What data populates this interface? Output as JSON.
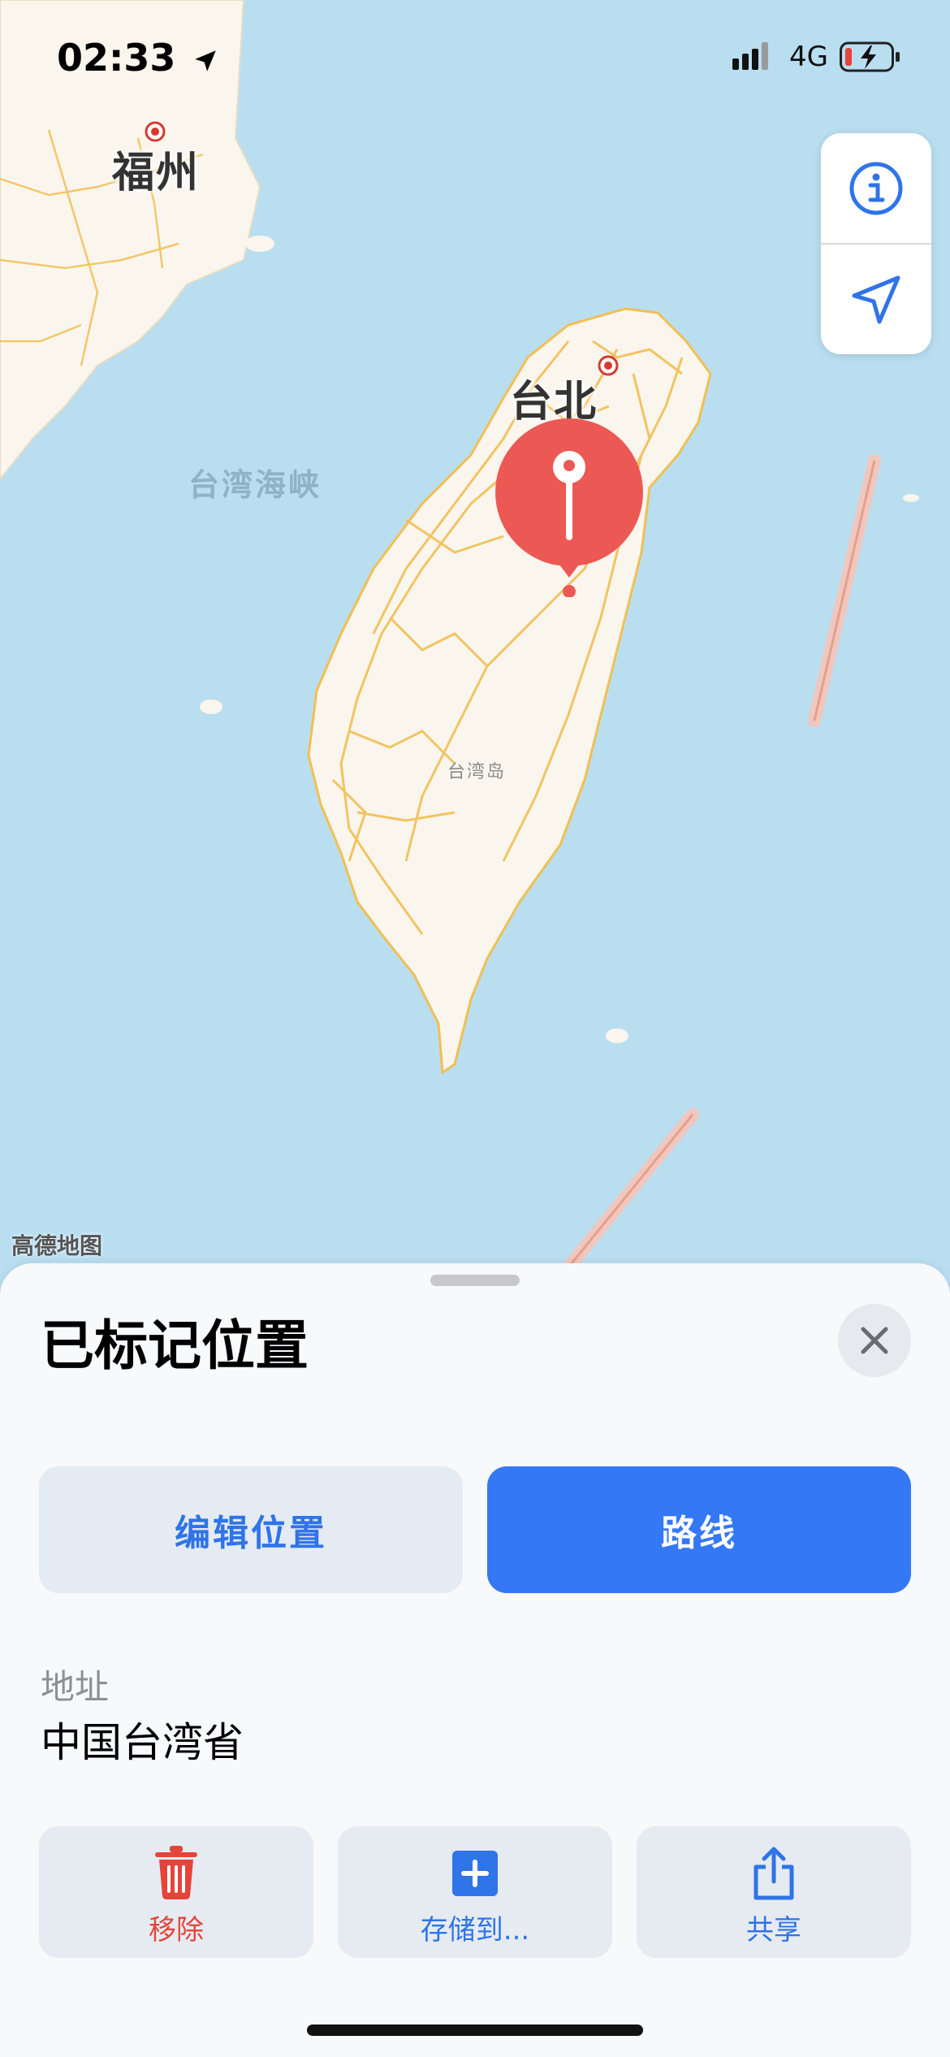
{
  "status_bar": {
    "time": "02:33",
    "network": "4G",
    "icons": [
      "location-arrow-icon",
      "signal-icon",
      "battery-charging-icon"
    ]
  },
  "map": {
    "cities": [
      "福州",
      "台北"
    ],
    "sea_label": "台湾海峡",
    "island_label": "台湾岛",
    "credit": "高德地图"
  },
  "map_controls": {
    "icons": [
      "info-icon",
      "location-arrow-icon"
    ]
  },
  "sheet": {
    "title": "已标记位置",
    "close_icon": "close-icon",
    "edit_label": "编辑位置",
    "route_label": "路线",
    "address_label": "地址",
    "address_value": "中国台湾省",
    "actions": [
      {
        "label": "移除",
        "icon": "trash-icon",
        "color": "#e5443a"
      },
      {
        "label": "存储到...",
        "icon": "add-square-icon",
        "color": "#2f74e8"
      },
      {
        "label": "共享",
        "icon": "share-icon",
        "color": "#2f74e8"
      }
    ]
  },
  "colors": {
    "accent": "#3478f6",
    "pin": "#ec5853",
    "destructive": "#e5443a",
    "water": "#b9def0",
    "land": "#faf6ee",
    "roads": "#f2bf52"
  }
}
